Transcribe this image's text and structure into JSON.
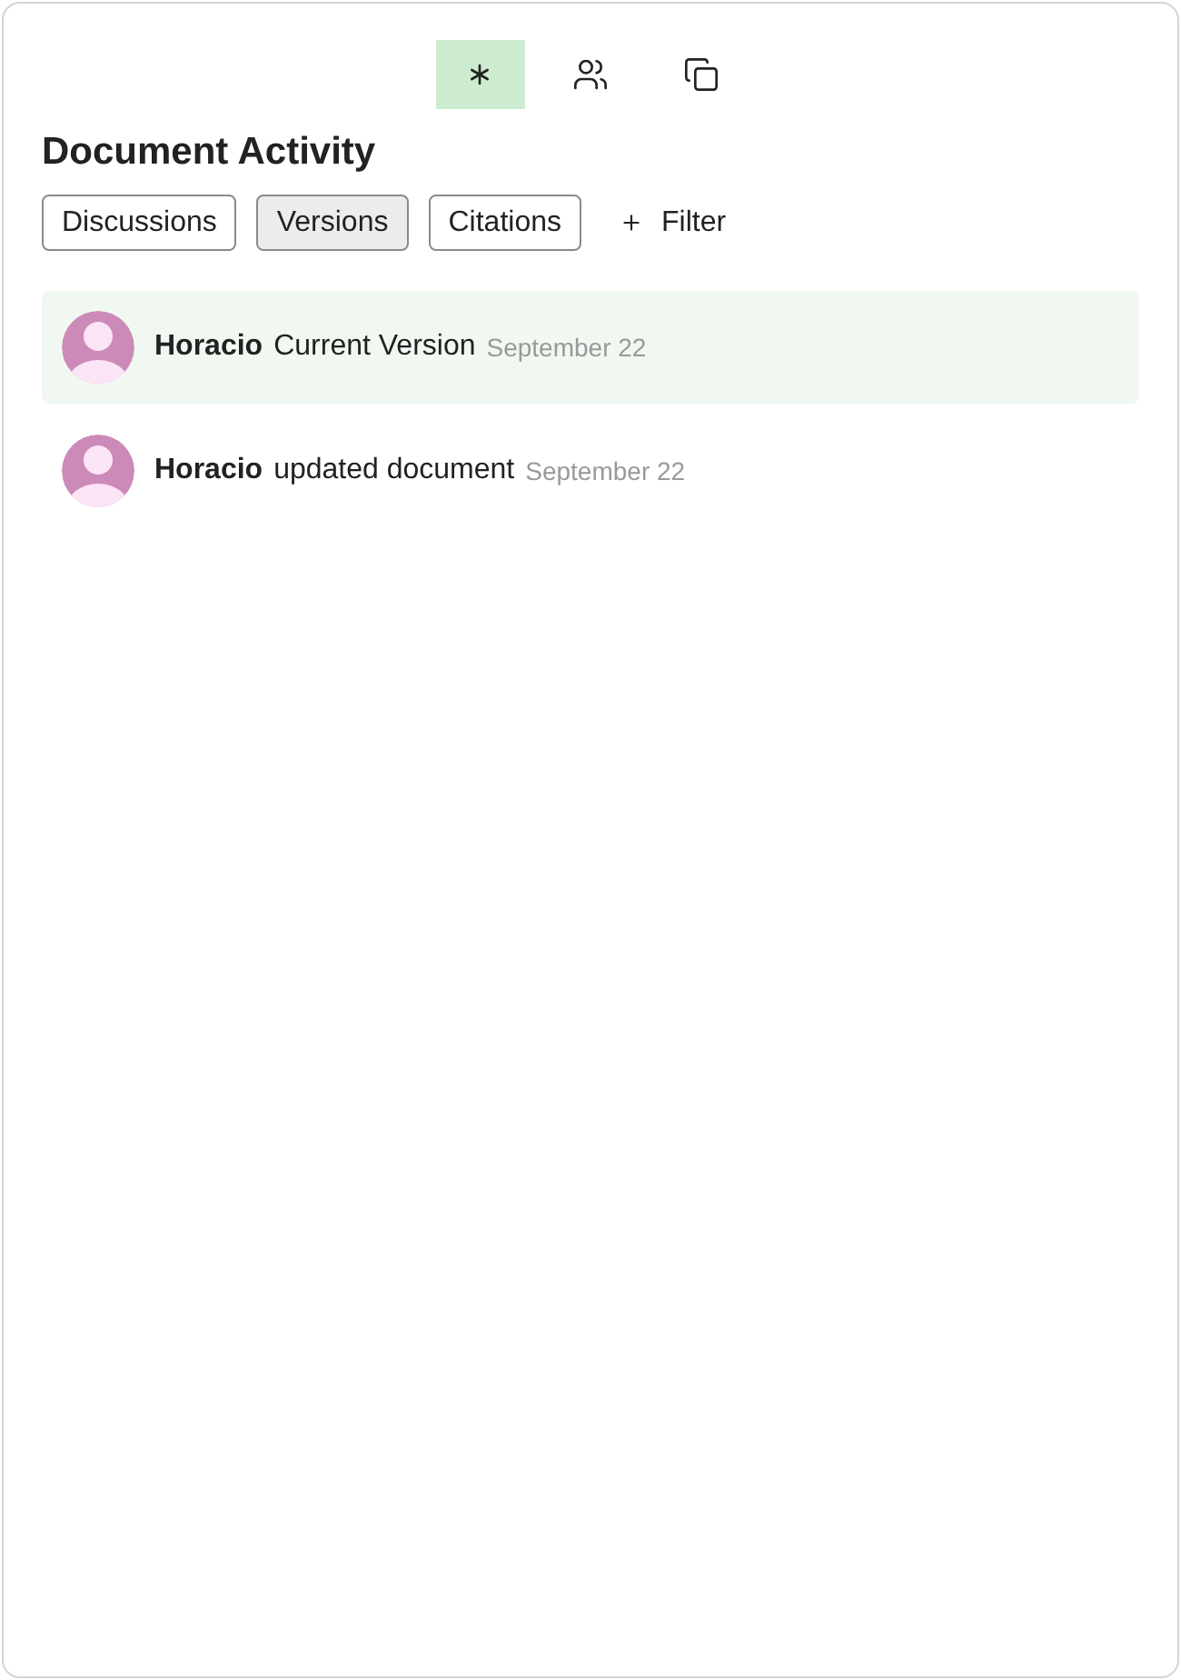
{
  "view_tabs": [
    {
      "kind": "activity",
      "selected": true
    },
    {
      "kind": "people",
      "selected": false
    },
    {
      "kind": "files",
      "selected": false
    }
  ],
  "title": "Document Activity",
  "filters": [
    {
      "label": "Discussions",
      "selected": false
    },
    {
      "label": "Versions",
      "selected": true
    },
    {
      "label": "Citations",
      "selected": false
    }
  ],
  "add_filter": {
    "label": "Filter"
  },
  "activities": [
    {
      "user": "Horacio",
      "action": "Current Version",
      "date": "September 22",
      "selected": true
    },
    {
      "user": "Horacio",
      "action": "updated document",
      "date": "September 22",
      "selected": false
    }
  ]
}
